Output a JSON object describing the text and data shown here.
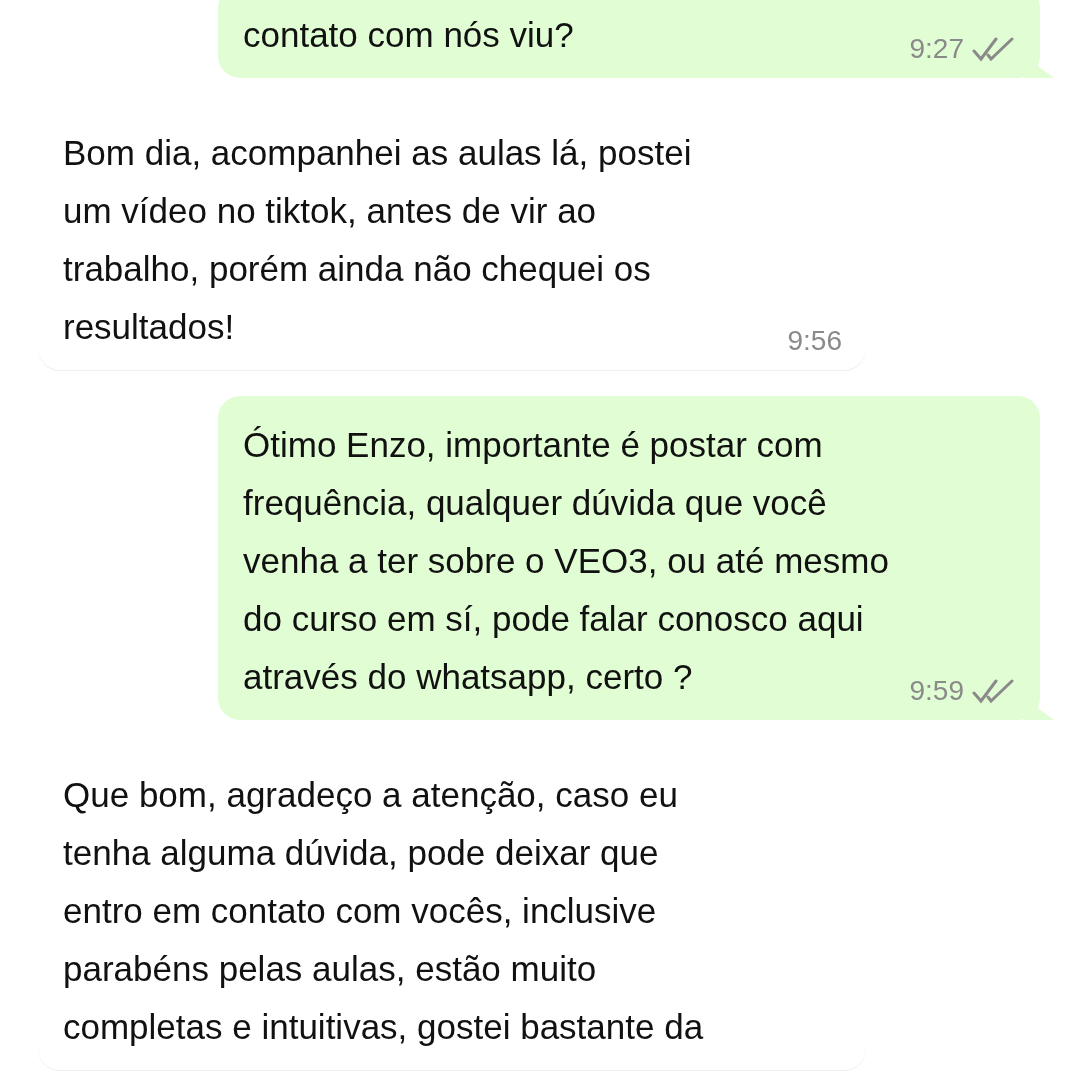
{
  "messages": [
    {
      "kind": "outgoing",
      "text": "contato com nós viu?",
      "time": "9:27",
      "read": false
    },
    {
      "kind": "incoming",
      "text": "Bom dia, acompanhei as aulas lá, postei um vídeo no tiktok, antes de vir ao trabalho, porém ainda não chequei os resultados!",
      "time": "9:56"
    },
    {
      "kind": "outgoing",
      "text": "Ótimo Enzo, importante é postar com frequência, qualquer dúvida que você venha a ter sobre o VEO3, ou até mesmo do curso em sí, pode falar conosco aqui através do whatsapp, certo ?",
      "time": "9:59",
      "read": false
    },
    {
      "kind": "incoming",
      "text": "Que bom, agradeço a atenção, caso eu tenha alguma dúvida, pode deixar que entro em contato com vocês, inclusive parabéns pelas aulas, estão muito completas e intuitivas, gostei bastante da"
    }
  ]
}
